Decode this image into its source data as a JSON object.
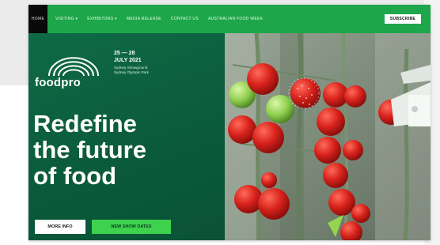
{
  "nav": {
    "home_label": "HOME",
    "items": [
      "VISITING ▾",
      "EXHIBITORS ▾",
      "MEDIA RELEASE",
      "CONTACT US",
      "AUSTRALIAN FOOD WEEK"
    ],
    "subscribe_label": "SUBSCRIBE"
  },
  "brand": {
    "logo_text": "foodpro"
  },
  "event": {
    "date_range": "25 — 28",
    "month_year": "JULY 2021",
    "venue_line1": "Sydney Showground",
    "venue_line2": "Sydney Olympic Park"
  },
  "hero": {
    "headline_lines": [
      "Redefine",
      "the future",
      "of food"
    ]
  },
  "buttons": {
    "more_info": "MORE INFO",
    "new_show_dates": "NEW SHOW DATES"
  },
  "colors": {
    "nav_green": "#1da74a",
    "panel_green": "#0b5e3d",
    "cta_green": "#3ed14e",
    "tomato_red": "#d8231c"
  }
}
